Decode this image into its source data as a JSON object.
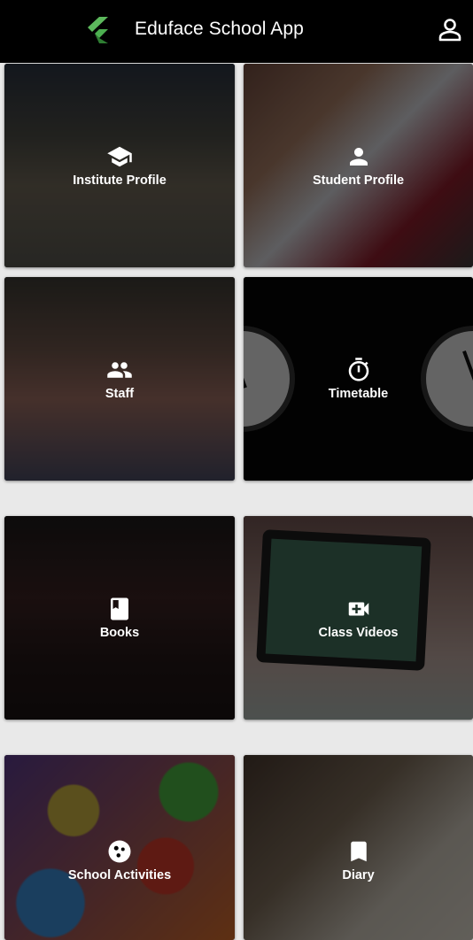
{
  "app": {
    "title": "Eduface School App",
    "colors": {
      "bar": "#000000",
      "accent_logo": "#4caf50",
      "text": "#ffffff"
    }
  },
  "tiles": [
    {
      "label": "Institute Profile",
      "icon": "school-icon"
    },
    {
      "label": "Student Profile",
      "icon": "person-icon"
    },
    {
      "label": "Staff",
      "icon": "people-icon"
    },
    {
      "label": "Timetable",
      "icon": "timer-icon"
    },
    {
      "label": "Books",
      "icon": "book-icon"
    },
    {
      "label": "Class Videos",
      "icon": "video-call-icon"
    },
    {
      "label": "School Activities",
      "icon": "cookie-icon"
    },
    {
      "label": "Diary",
      "icon": "bookmark-icon"
    }
  ]
}
